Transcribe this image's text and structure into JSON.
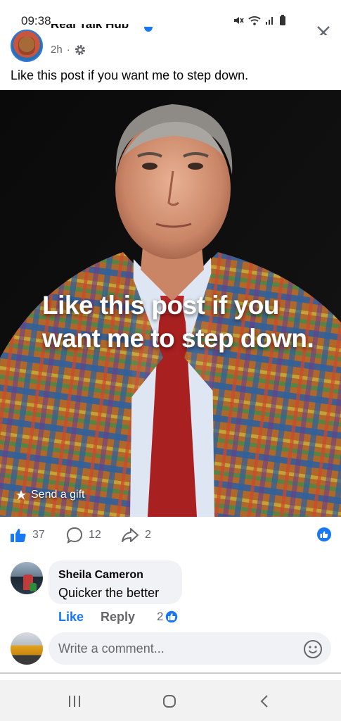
{
  "status_bar": {
    "time": "09:38"
  },
  "post": {
    "page_name": "Real Talk Hub",
    "time_ago": "2h",
    "separator": "·",
    "text": "Like this post if you want me to step down.",
    "image_text_line1": "Like this post if you",
    "image_text_line2": "want me to step down.",
    "gift_label": "Send a gift"
  },
  "reactions": {
    "likes": "37",
    "comments": "12",
    "shares": "2"
  },
  "comment": {
    "author": "Sheila Cameron",
    "text": "Quicker the better",
    "like_label": "Like",
    "reply_label": "Reply",
    "reaction_count": "2"
  },
  "composer": {
    "placeholder": "Write a comment..."
  },
  "colors": {
    "accent": "#1877f2",
    "muted": "#65676b",
    "bubble": "#f0f2f5"
  },
  "icons": [
    "mute-icon",
    "wifi-icon",
    "signal-icon",
    "battery-icon",
    "verified-icon",
    "gear-icon",
    "close-icon",
    "gift-icon",
    "thumbs-up-icon",
    "comment-icon",
    "share-icon",
    "emoji-icon",
    "recents-icon",
    "home-icon",
    "back-icon"
  ]
}
